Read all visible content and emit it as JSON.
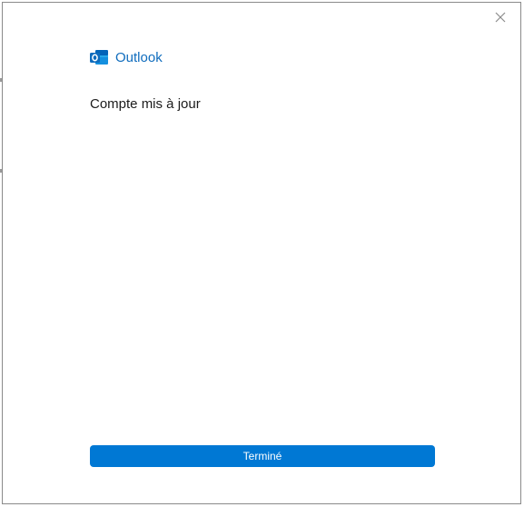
{
  "app": {
    "brand_name": "Outlook",
    "brand_color": "#0f6cbd"
  },
  "dialog": {
    "title": "Compte mis à jour",
    "close_icon": "close-icon"
  },
  "footer": {
    "done_label": "Terminé",
    "done_color": "#0078d4"
  }
}
